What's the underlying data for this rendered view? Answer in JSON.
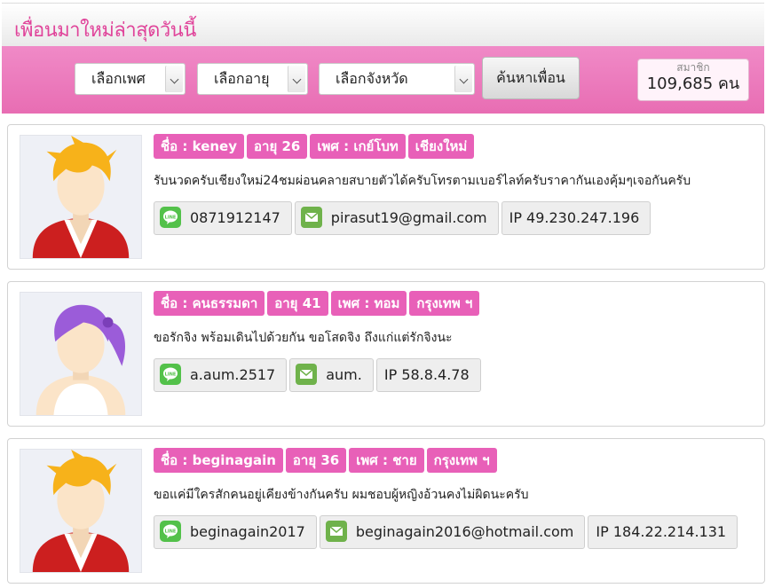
{
  "header": {
    "title": "เพื่อนมาใหม่ล่าสุดวันนี้"
  },
  "filters": {
    "gender": "เลือกเพศ",
    "age": "เลือกอายุ",
    "province": "เลือกจังหวัด",
    "search_label": "ค้นหาเพื่อน"
  },
  "members": {
    "label": "สมาชิก",
    "count": "109,685 คน"
  },
  "colors": {
    "accent": "#e860b8",
    "line": "#53c14a",
    "mail": "#6fb24b"
  },
  "profiles": [
    {
      "name": "ชื่อ : keney",
      "age": "อายุ 26",
      "gender": "เพศ : เกย์โบท",
      "province": "เชียงใหม่",
      "description": "รับนวดครับเชียงใหม่24ชมผ่อนคลายสบายตัวได้ครับโทรตามเบอร์ไลท์ครับราคากันเองคุ้มๆเจอกันครับ",
      "line": "0871912147",
      "email": "pirasut19@gmail.com",
      "ip": "IP 49.230.247.196",
      "avatar_icon": "male-avatar-icon"
    },
    {
      "name": "ชื่อ : คนธรรมดา",
      "age": "อายุ 41",
      "gender": "เพศ : ทอม",
      "province": "กรุงเทพ ฯ",
      "description": "ขอรักจิง พร้อมเดินไปด้วยกัน ขอโสดจิง ถึงแก่แต่รักจิงนะ",
      "line": "a.aum.2517",
      "email": "aum.",
      "ip": "IP 58.8.4.78",
      "avatar_icon": "female-avatar-icon"
    },
    {
      "name": "ชื่อ : beginagain",
      "age": "อายุ 36",
      "gender": "เพศ : ชาย",
      "province": "กรุงเทพ ฯ",
      "description": "ขอแค่มีใครสักคนอยู่เคียงข้างกันครับ ผมชอบผู้หญิงอ้วนคงไม่ผิดนะครับ",
      "line": "beginagain2017",
      "email": "beginagain2016@hotmail.com",
      "ip": "IP 184.22.214.131",
      "avatar_icon": "male-avatar-icon"
    }
  ]
}
